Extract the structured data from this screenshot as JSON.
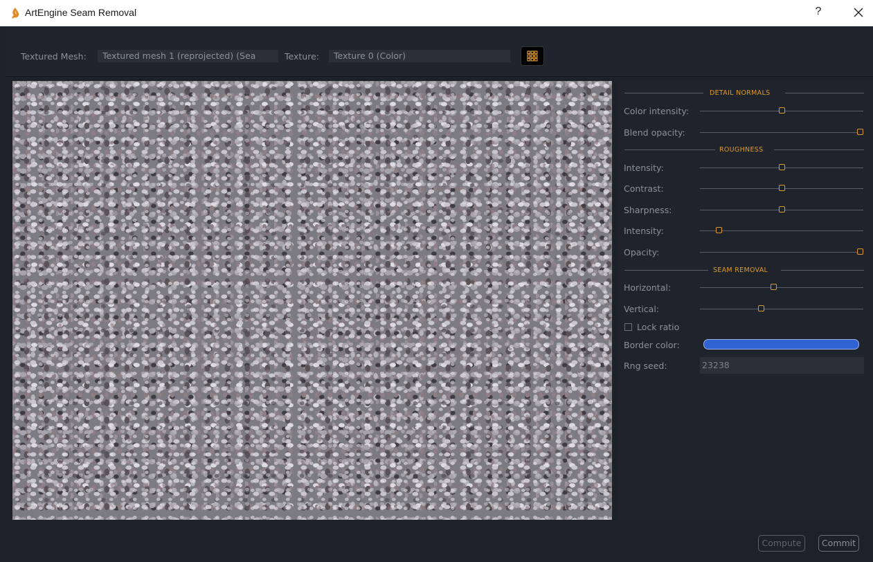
{
  "window": {
    "title": "ArtEngine Seam Removal",
    "help_label": "?"
  },
  "toolbar": {
    "mesh_label": "Textured Mesh:",
    "mesh_value": "Textured mesh 1 (reprojected) (Sea",
    "texture_label": "Texture:",
    "texture_value": "Texture 0 (Color)"
  },
  "panel": {
    "sections": {
      "detail_normals": "DETAIL NORMALS",
      "roughness": "ROUGHNESS",
      "seam_removal": "SEAM REMOVAL"
    },
    "sliders": [
      {
        "label": "Color intensity:",
        "value": 0.5
      },
      {
        "label": "Blend opacity:",
        "value": 1.0
      },
      {
        "label": "Intensity:",
        "value": 0.5
      },
      {
        "label": "Contrast:",
        "value": 0.5
      },
      {
        "label": "Sharpness:",
        "value": 0.5
      },
      {
        "label": "Intensity:",
        "value": 0.1
      },
      {
        "label": "Opacity:",
        "value": 1.0
      },
      {
        "label": "Horizontal:",
        "value": 0.45
      },
      {
        "label": "Vertical:",
        "value": 0.37
      }
    ],
    "lock_ratio_label": "Lock ratio",
    "lock_ratio_checked": false,
    "border_color_label": "Border color:",
    "border_color": "#2e63d1",
    "rng_seed_label": "Rng seed:",
    "rng_seed_value": "23238"
  },
  "buttons": {
    "compute": "Compute",
    "commit": "Commit"
  },
  "colors": {
    "accent": "#e09a2a",
    "background": "#1d212a"
  }
}
